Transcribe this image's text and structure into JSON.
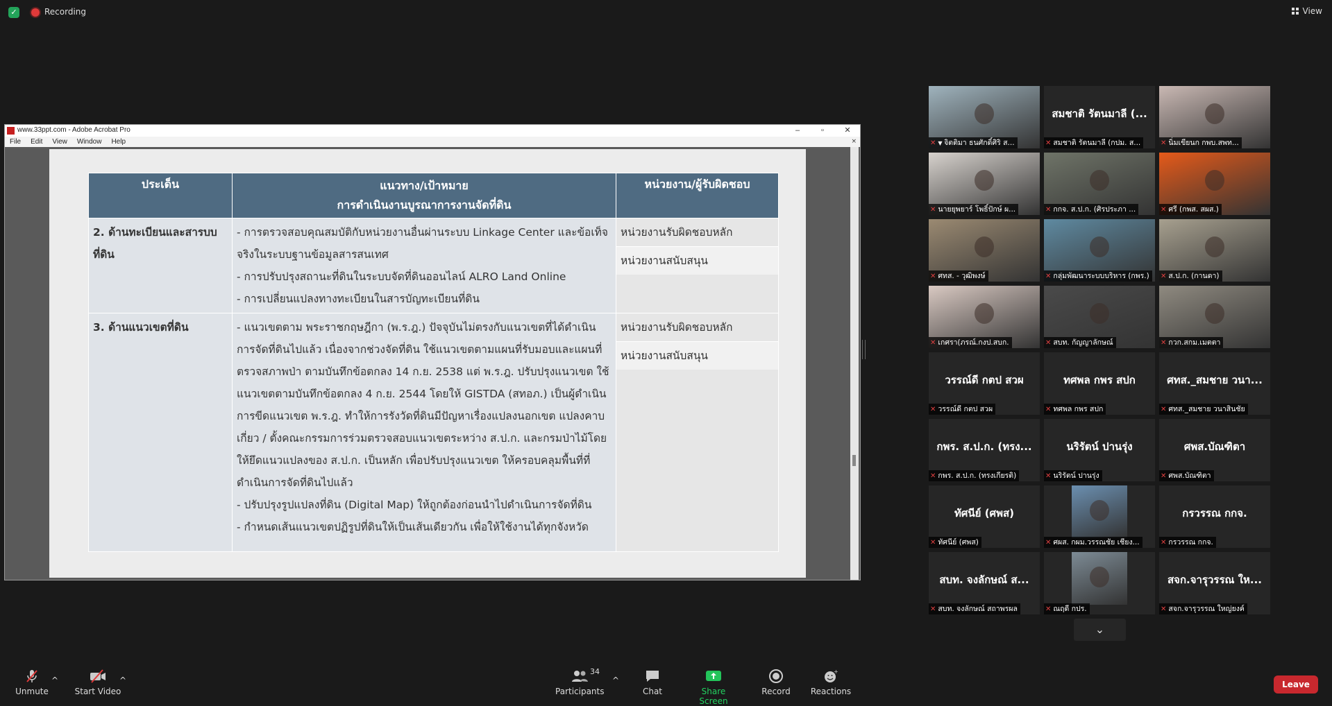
{
  "zoom": {
    "recording_label": "Recording",
    "view_label": "View",
    "toolbar": {
      "unmute": "Unmute",
      "start_video": "Start Video",
      "participants": "Participants",
      "participant_count": "34",
      "chat": "Chat",
      "share_screen": "Share Screen",
      "record": "Record",
      "reactions": "Reactions",
      "leave": "Leave"
    }
  },
  "acrobat": {
    "title": "www.33ppt.com - Adobe Acrobat Pro",
    "menu": [
      "File",
      "Edit",
      "View",
      "Window",
      "Help"
    ],
    "controls": {
      "minimize": "–",
      "maximize": "▫",
      "close": "✕",
      "doc_close": "×"
    }
  },
  "slide": {
    "headers": [
      "ประเด็น",
      "แนวทาง/เป้าหมาย\nการดำเนินงานบูรณาการงานจัดที่ดิน",
      "หน่วยงาน/ผู้รับผิดชอบ"
    ],
    "rows": [
      {
        "topic": "2. ด้านทะเบียนและสารบบที่ดิน",
        "details": "- การตรวจสอบคุณสมบัติกับหน่วยงานอื่นผ่านระบบ Linkage Center และข้อเท็จจริงในระบบฐานข้อมูลสารสนเทศ\n- การปรับปรุงสถานะที่ดินในระบบจัดที่ดินออนไลน์ ALRO Land Online\n- การเปลี่ยนแปลงทางทะเบียนในสารบัญทะเบียนที่ดิน",
        "primary": "หน่วยงานรับผิดชอบหลัก",
        "support": "หน่วยงานสนับสนุน"
      },
      {
        "topic": "3. ด้านแนวเขตที่ดิน",
        "details": "- แนวเขตตาม พระราชกฤษฎีกา (พ.ร.ฎ.) ปัจจุบันไม่ตรงกับแนวเขตที่ได้ดำเนินการจัดที่ดินไปแล้ว เนื่องจากช่วงจัดที่ดิน ใช้แนวเขตตามแผนที่รับมอบและแผนที่ตรวจสภาพป่า ตามบันทึกข้อตกลง 14 ก.ย. 2538 แต่ พ.ร.ฎ. ปรับปรุงแนวเขต ใช้แนวเขตตามบันทึกข้อตกลง 4 ก.ย. 2544 โดยให้ GISTDA (สทอภ.) เป็นผู้ดำเนินการขีดแนวเขต พ.ร.ฎ. ทำให้การรังวัดที่ดินมีปัญหาเรื่องแปลงนอกเขต แปลงคาบเกี่ยว / ตั้งคณะกรรมการร่วมตรวจสอบแนวเขตระหว่าง ส.ป.ก. และกรมป่าไม้โดยให้ยึดแนวแปลงของ ส.ป.ก. เป็นหลัก เพื่อปรับปรุงแนวเขต ให้ครอบคลุมพื้นที่ที่ดำเนินการจัดที่ดินไปแล้ว\n- ปรับปรุงรูปแปลงที่ดิน (Digital Map) ให้ถูกต้องก่อนนำไปดำเนินการจัดที่ดิน\n- กำหนดเส้นแนวเขตปฏิรูปที่ดินให้เป็นเส้นเดียวกัน เพื่อให้ใช้งานได้ทุกจังหวัด",
        "primary": "หน่วยงานรับผิดชอบหลัก",
        "support": "หน่วยงานสนับสนุน"
      }
    ]
  },
  "gallery": [
    {
      "label": "จิตติมา ธนศักดิ์ศิริ ส...",
      "name": "",
      "video": true,
      "pinned": true,
      "bg": "#9fb3bd"
    },
    {
      "label": "สมชาติ รัตนมาลี (กปม. ส...",
      "name": "สมชาติ รัตนมาลี (...",
      "video": false
    },
    {
      "label": "นิ่มเขียนก กพบ.สพท...",
      "name": "",
      "video": true,
      "bg": "#c9b8b3"
    },
    {
      "label": "นายยุพยาร์ โพธิ์ปักษ์ ผ...",
      "name": "",
      "video": true,
      "bg": "#d7d2cd"
    },
    {
      "label": "กกจ. ส.ป.ก. (ศิรประภา ...",
      "name": "",
      "video": true,
      "bg": "#6f7468"
    },
    {
      "label": "ศรี (กพส. สผส.)",
      "name": "",
      "video": true,
      "bg": "#e55a1a"
    },
    {
      "label": "ศทส. - วุฒิพงษ์",
      "name": "",
      "video": true,
      "bg": "#9b8a72"
    },
    {
      "label": "กลุ่มพัฒนาระบบบริหาร (กพร.)",
      "name": "",
      "video": true,
      "bg": "#5f8aa1",
      "active": true
    },
    {
      "label": "ส.ป.ก. (กานดา)",
      "name": "",
      "video": true,
      "bg": "#a7a08f"
    },
    {
      "label": "เกศรา(ภรณ์.กงป.สบก.",
      "name": "",
      "video": true,
      "bg": "#d9c9c2"
    },
    {
      "label": "สบท. กัญญาลักษณ์",
      "name": "",
      "video": true,
      "bg": "#4a4a4a"
    },
    {
      "label": "กวก.สกม.เมตตา",
      "name": "",
      "video": true,
      "bg": "#8f8a80"
    },
    {
      "label": "วรรณ์ดี กตป สวผ",
      "name": "วรรณ์ดี กตป สวผ",
      "video": false
    },
    {
      "label": "ทศพล กพร สปก",
      "name": "ทศพล กพร สปก",
      "video": false
    },
    {
      "label": "ศทส._สมชาย วนาสินชัย",
      "name": "ศทส._สมชาย วนา...",
      "video": false
    },
    {
      "label": "กพร. ส.ป.ก. (ทรงเกียรติ)",
      "name": "กพร. ส.ป.ก. (ทรง...",
      "video": false
    },
    {
      "label": "นริรัตน์ ปานรุ่ง",
      "name": "นริรัตน์ ปานรุ่ง",
      "video": false
    },
    {
      "label": "ศพส.บัณฑิตา",
      "name": "ศพส.บัณฑิตา",
      "video": false
    },
    {
      "label": "ทัศนีย์ (ศพส)",
      "name": "ทัศนีย์ (ศพส)",
      "video": false
    },
    {
      "label": "ศผส. กผม.วรรณชัย เชียง...",
      "name": "",
      "video": true,
      "small": true,
      "bg": "#6b8fb0"
    },
    {
      "label": "กรวรรณ กกจ.",
      "name": "กรวรรณ กกจ.",
      "video": false
    },
    {
      "label": "สบท. จงลักษณ์ สถาพรผล",
      "name": "สบท. จงลักษณ์ ส...",
      "video": false
    },
    {
      "label": "ณฤดี กปร.",
      "name": "",
      "video": true,
      "small": true,
      "bg": "#7d8b95"
    },
    {
      "label": "สจก.จารุวรรณ ใหญ่ยงค์",
      "name": "สจก.จารุวรรณ ให...",
      "video": false
    }
  ],
  "gallery_next": "chevron-down"
}
